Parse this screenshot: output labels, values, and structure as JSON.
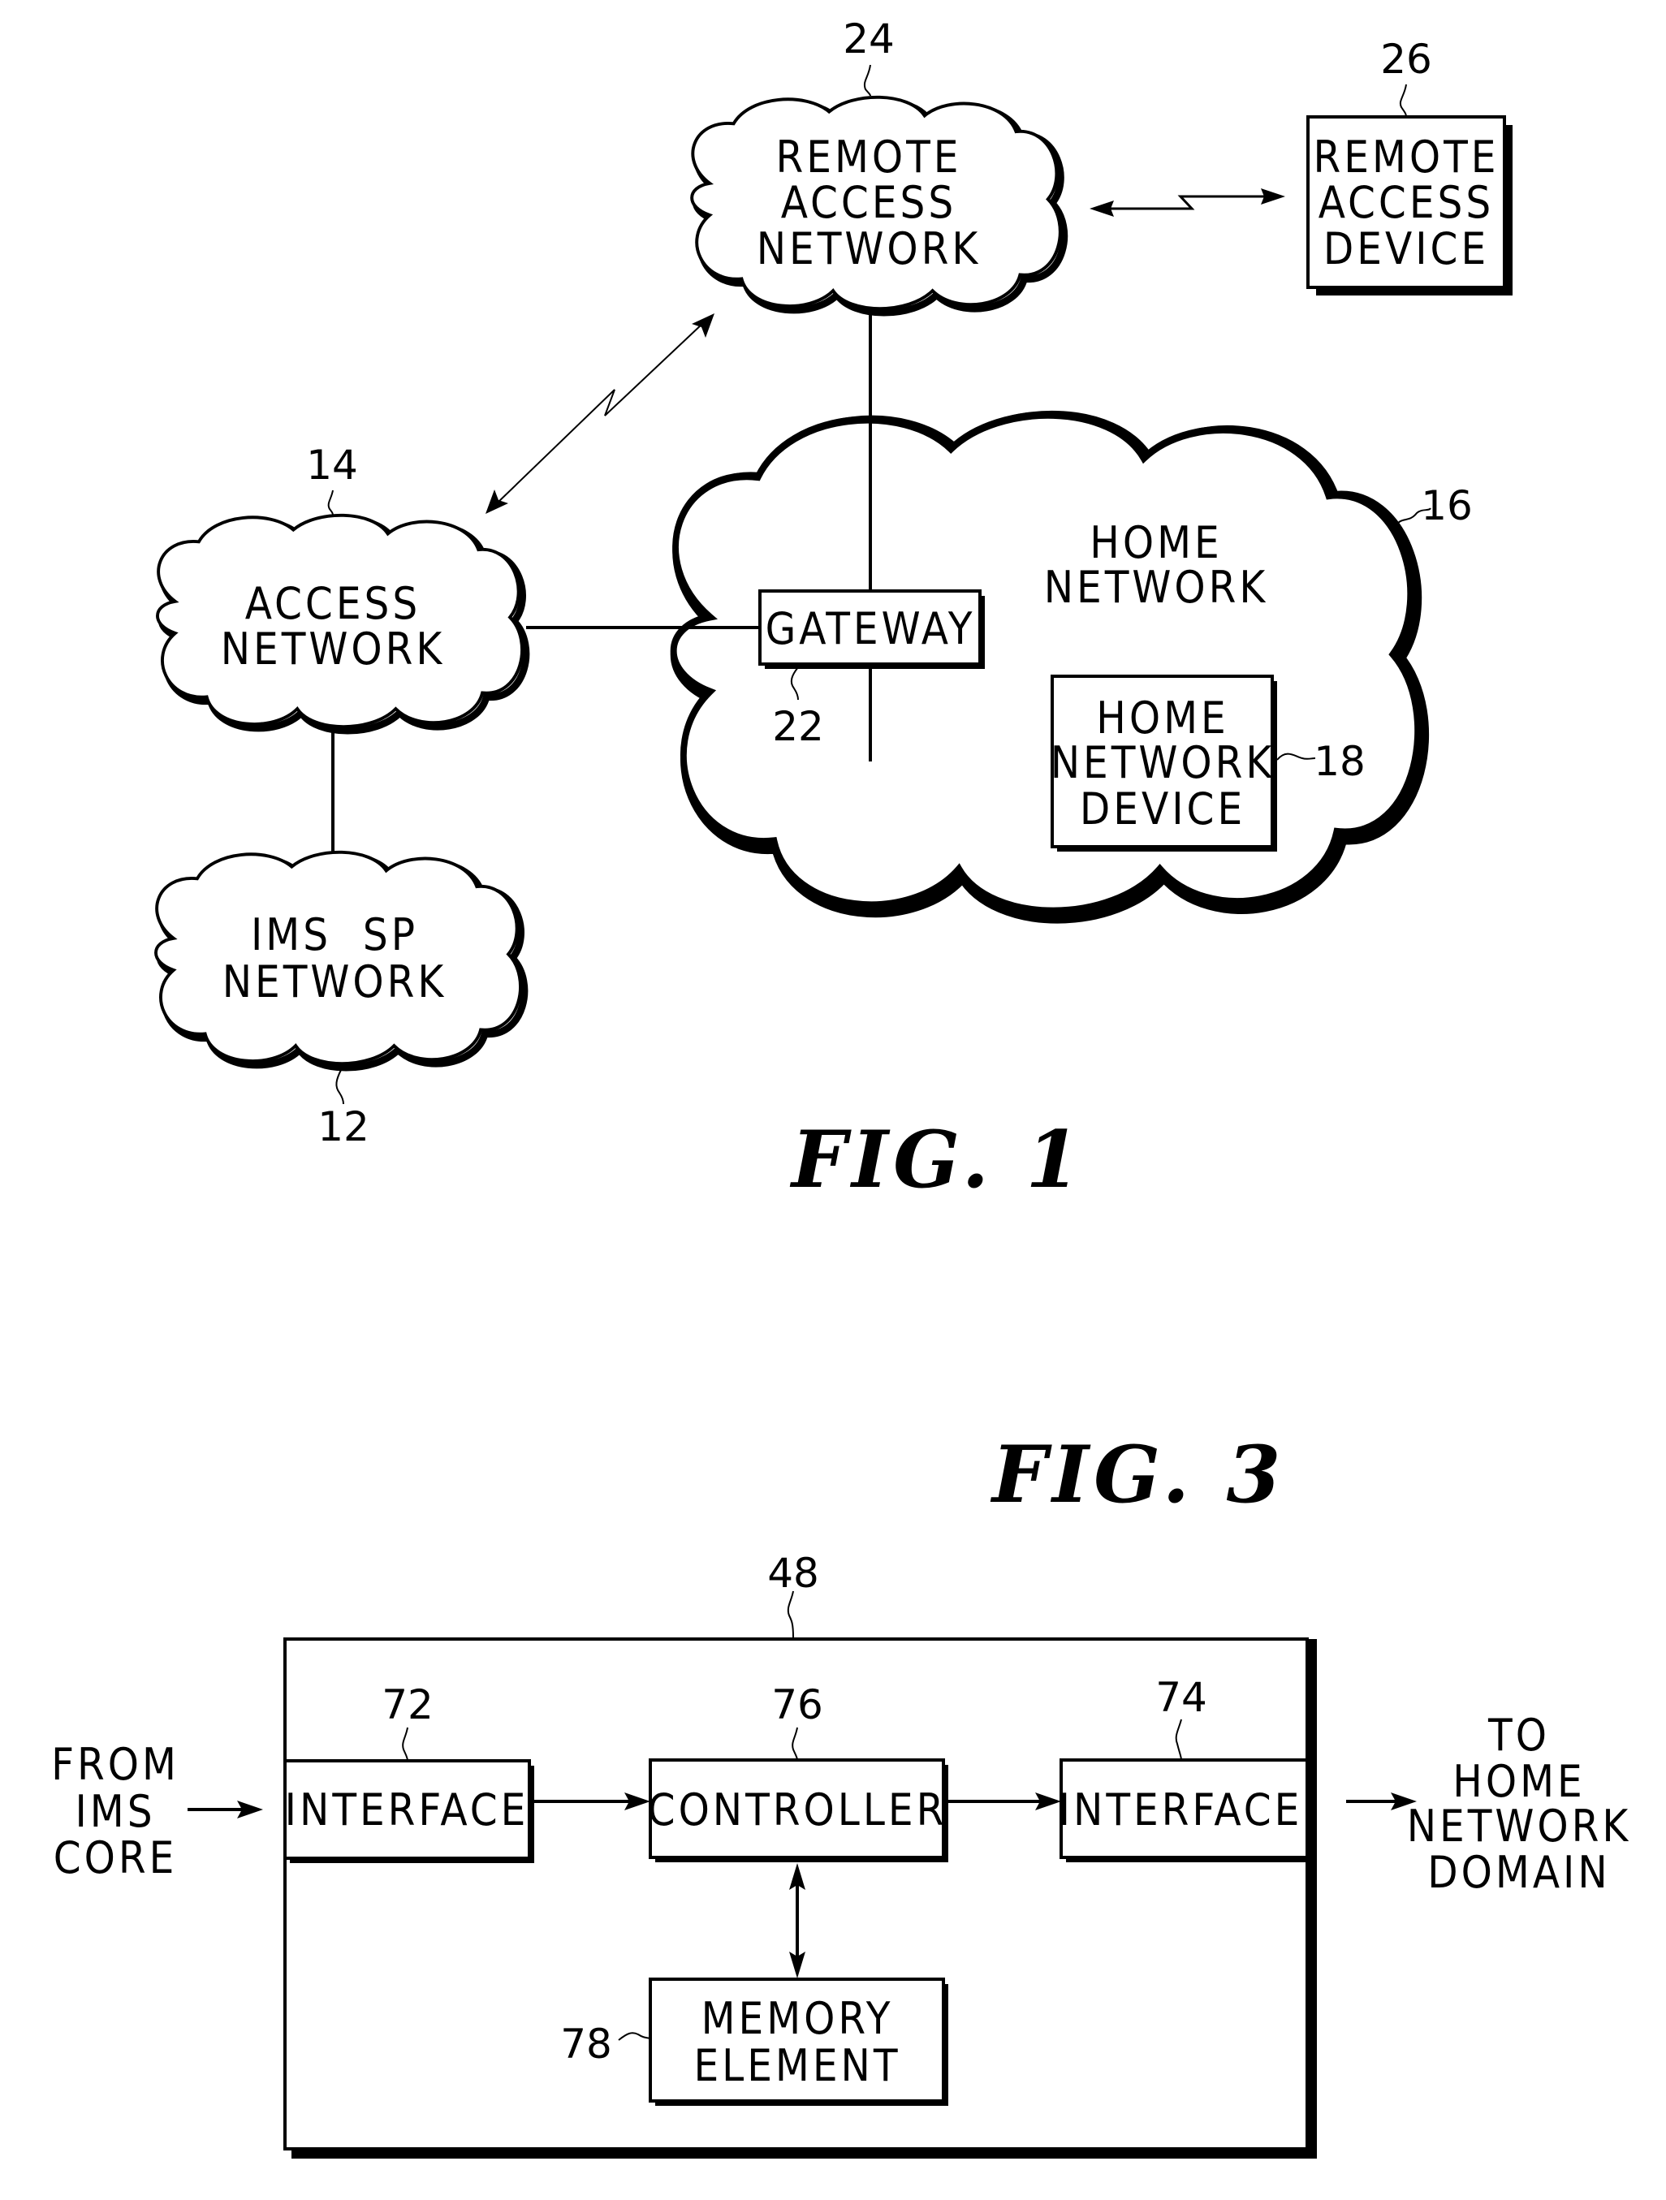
{
  "fig1": {
    "title": "FIG. 1",
    "nodes": {
      "remote_access_network": {
        "lines": [
          "REMOTE",
          "ACCESS",
          "NETWORK"
        ],
        "ref": "24",
        "shape": "cloud"
      },
      "remote_access_device": {
        "lines": [
          "REMOTE",
          "ACCESS",
          "DEVICE"
        ],
        "ref": "26",
        "shape": "box"
      },
      "access_network": {
        "lines": [
          "ACCESS",
          "NETWORK"
        ],
        "ref": "14",
        "shape": "cloud"
      },
      "ims_sp_network": {
        "lines": [
          "IMS  SP",
          "NETWORK"
        ],
        "ref": "12",
        "shape": "cloud"
      },
      "home_network": {
        "lines": [
          "HOME",
          "NETWORK"
        ],
        "ref": "16",
        "shape": "cloud"
      },
      "gateway": {
        "lines": [
          "GATEWAY"
        ],
        "ref": "22",
        "shape": "box"
      },
      "home_network_device": {
        "lines": [
          "HOME",
          "NETWORK",
          "DEVICE"
        ],
        "ref": "18",
        "shape": "box"
      }
    },
    "edges": [
      {
        "from": "remote_access_network",
        "to": "remote_access_device",
        "type": "wireless-bidirectional"
      },
      {
        "from": "remote_access_network",
        "to": "access_network",
        "type": "wireless-bidirectional"
      },
      {
        "from": "remote_access_network",
        "to": "gateway",
        "type": "wired"
      },
      {
        "from": "access_network",
        "to": "gateway",
        "type": "wired"
      },
      {
        "from": "access_network",
        "to": "ims_sp_network",
        "type": "wired"
      },
      {
        "from": "gateway",
        "to": "home_network_device",
        "type": "wired"
      }
    ]
  },
  "fig3": {
    "title": "FIG. 3",
    "container_ref": "48",
    "input_label": [
      "FROM",
      "IMS",
      "CORE"
    ],
    "output_label": [
      "TO",
      "HOME",
      "NETWORK",
      "DOMAIN"
    ],
    "blocks": {
      "interface_in": {
        "label": "INTERFACE",
        "ref": "72"
      },
      "controller": {
        "label": "CONTROLLER",
        "ref": "76"
      },
      "interface_out": {
        "label": "INTERFACE",
        "ref": "74"
      },
      "memory": {
        "lines": [
          "MEMORY",
          "ELEMENT"
        ],
        "ref": "78"
      }
    },
    "edges": [
      {
        "from": "input",
        "to": "interface_in",
        "type": "arrow"
      },
      {
        "from": "interface_in",
        "to": "controller",
        "type": "arrow"
      },
      {
        "from": "controller",
        "to": "interface_out",
        "type": "arrow"
      },
      {
        "from": "interface_out",
        "to": "output",
        "type": "arrow"
      },
      {
        "from": "controller",
        "to": "memory",
        "type": "bidirectional-arrow"
      }
    ]
  }
}
